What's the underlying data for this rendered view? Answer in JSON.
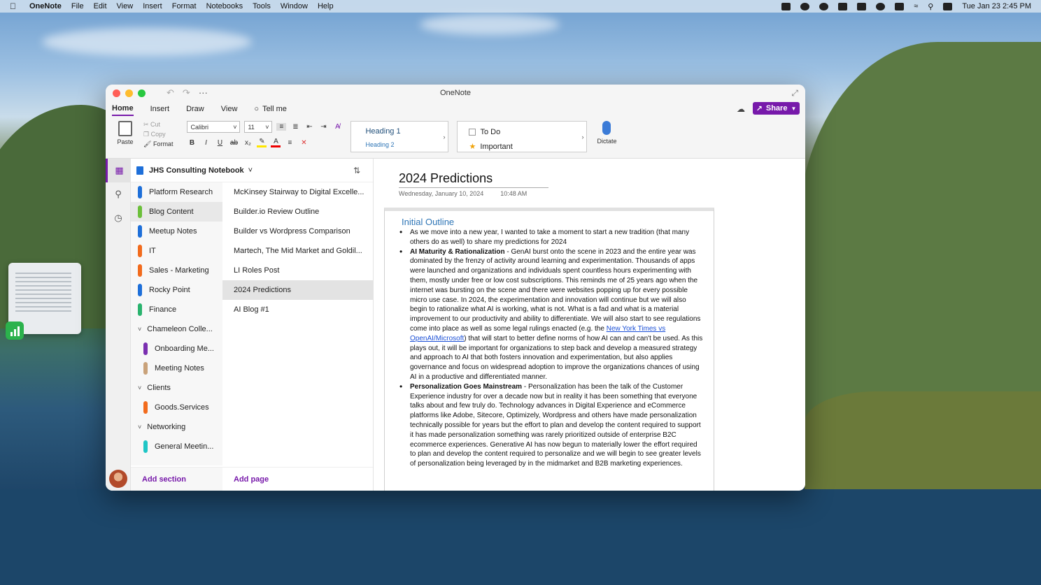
{
  "menubar": {
    "app_name": "OneNote",
    "items": [
      "File",
      "Edit",
      "View",
      "Insert",
      "Format",
      "Notebooks",
      "Tools",
      "Window",
      "Help"
    ],
    "clock": "Tue Jan 23  2:45 PM"
  },
  "window": {
    "title": "OneNote",
    "tabs": [
      "Home",
      "Insert",
      "Draw",
      "View"
    ],
    "tell_me": "Tell me",
    "share_label": "Share"
  },
  "toolbar": {
    "paste": "Paste",
    "cut": "Cut",
    "copy": "Copy",
    "format": "Format",
    "font": "Calibri",
    "size": "11",
    "heading1": "Heading 1",
    "heading2": "Heading 2",
    "tag_todo": "To Do",
    "tag_important": "Important",
    "dictate": "Dictate"
  },
  "notebook": {
    "name": "JHS Consulting Notebook",
    "add_section": "Add section",
    "add_page": "Add page",
    "sections": [
      {
        "label": "Platform Research",
        "color": "#1e6fd9"
      },
      {
        "label": "Blog Content",
        "color": "#6bbf3a",
        "selected": true
      },
      {
        "label": "Meetup Notes",
        "color": "#1e6fd9"
      },
      {
        "label": "IT",
        "color": "#f26b1d"
      },
      {
        "label": "Sales - Marketing",
        "color": "#f26b1d"
      },
      {
        "label": "Rocky Point",
        "color": "#1e6fd9"
      },
      {
        "label": "Finance",
        "color": "#2ab36e"
      }
    ],
    "groups": [
      {
        "label": "Chameleon Colle...",
        "children": [
          {
            "label": "Onboarding Me...",
            "color": "#7a2fb0"
          },
          {
            "label": "Meeting Notes",
            "color": "#c9a27a"
          }
        ]
      },
      {
        "label": "Clients",
        "children": [
          {
            "label": "Goods.Services",
            "color": "#f26b1d"
          }
        ]
      },
      {
        "label": "Networking",
        "children": [
          {
            "label": "General Meetin...",
            "color": "#1fc6c6"
          }
        ]
      }
    ],
    "pages": [
      "McKinsey Stairway to Digital Excelle...",
      "Builder.io Review Outline",
      "Builder vs Wordpress Comparison",
      "Martech, The Mid Market and Goldil...",
      "LI Roles Post",
      "2024 Predictions",
      "AI Blog #1"
    ],
    "selected_page": 5
  },
  "page": {
    "title": "2024 Predictions",
    "date": "Wednesday, January 10, 2024",
    "time": "10:48 AM",
    "heading": "Initial Outline",
    "bullet1": "As we move into a new year, I wanted to take a moment to start a new tradition (that many others do as well) to share my predictions for 2024",
    "bullet2_bold": "AI Maturity & Rationalization",
    "bullet2_a": " - GenAI burst onto the scene in 2023 and the entire year was dominated by the frenzy of activity around learning and experimentation. Thousands of apps were launched and organizations and individuals spent countless hours experimenting with them, mostly under free or low cost subscriptions.  This reminds me of 25 years ago when the internet was bursting on the scene and there were websites popping up for every possible micro use case.   In 2024, the experimentation and innovation will continue but we will also begin to rationalize what AI is working, what is not.  What is a fad and what is a material improvement to our productivity and ability to differentiate.   We will also start to see regulations come into place as well as some legal rulings enacted (e.g. the ",
    "bullet2_link": "New York Times vs OpenAI/Microsoft",
    "bullet2_b": ") that will start to better define norms of how AI can and can't be used.   As this plays out, it will be important for organizations to step back and develop a measured strategy and approach to AI that both fosters innovation and experimentation, but also applies governance and focus on widespread adoption to improve the organizations chances of using AI in a productive and differentiated manner.",
    "bullet3_bold": "Personalization Goes Mainstream",
    "bullet3": " - Personalization has been the talk of the Customer Experience industry  for over a decade now but in reality it has been something that everyone talks about and few truly do.   Technology advances in Digital Experience and eCommerce platforms like Adobe, Sitecore, Optimizely, Wordpress and others have made personalization technically possible for years but the effort to plan and develop the content required to support it has made personalization something was rarely prioritized outside of enterprise B2C ecommerce experiences.   Generative AI has now begun to materially lower the effort required to plan and develop the content required to personalize and we will begin to see greater levels of personalization being leveraged by in the midmarket and B2B marketing experiences."
  }
}
